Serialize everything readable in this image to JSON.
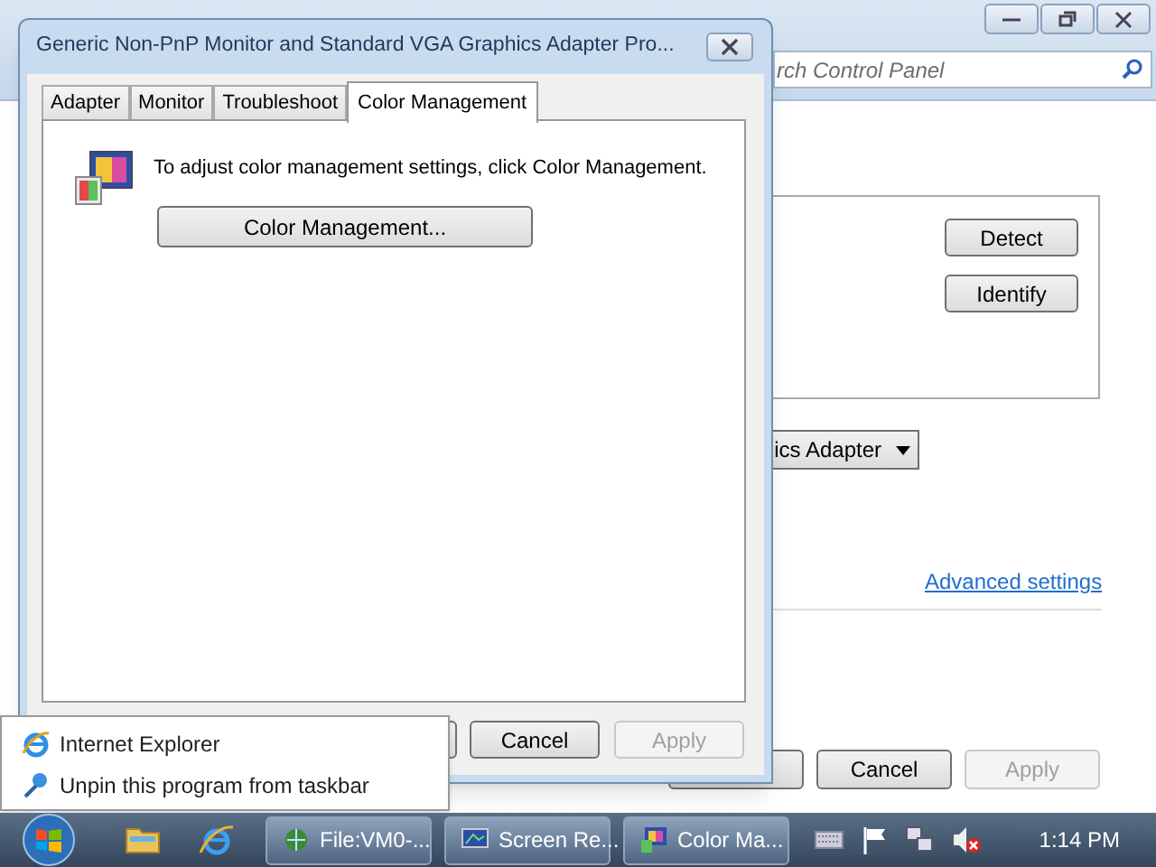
{
  "control_panel": {
    "search": {
      "placeholder": "rch Control Panel"
    },
    "side_buttons": [
      {
        "label": "Detect"
      },
      {
        "label": "Identify"
      }
    ],
    "dropdown": {
      "value": "ics Adapter"
    },
    "link": "Advanced settings",
    "buttons": [
      {
        "label": "Cancel",
        "disabled": false
      },
      {
        "label": "Apply",
        "disabled": true
      }
    ]
  },
  "dialog": {
    "title": "Generic Non-PnP Monitor and Standard VGA Graphics Adapter Pro...",
    "tabs": [
      {
        "label": "Adapter",
        "selected": false
      },
      {
        "label": "Monitor",
        "selected": false
      },
      {
        "label": "Troubleshoot",
        "selected": false
      },
      {
        "label": "Color Management",
        "selected": true
      }
    ],
    "description": "To adjust color management settings, click Color Management.",
    "action_button": "Color Management...",
    "buttons": [
      {
        "label": "Cancel",
        "disabled": false
      },
      {
        "label": "Apply",
        "disabled": true
      }
    ]
  },
  "jump_list": [
    {
      "kind": "program",
      "label": "Internet Explorer"
    },
    {
      "kind": "task",
      "label": "Unpin this program from taskbar"
    }
  ],
  "taskbar": {
    "buttons": [
      {
        "kind": "file",
        "label": "File:VM0-..."
      },
      {
        "kind": "screen",
        "label": "Screen Re..."
      },
      {
        "kind": "color",
        "label": "Color Ma..."
      }
    ],
    "clock": "1:14 PM"
  }
}
